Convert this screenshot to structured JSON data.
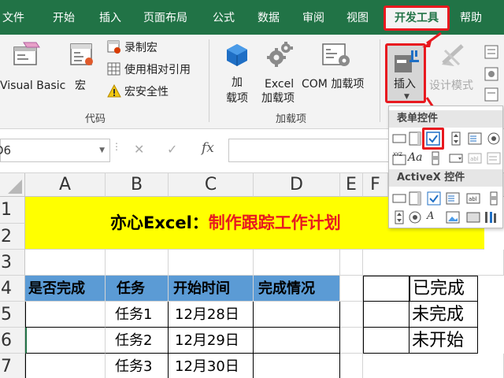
{
  "tabs": [
    "文件",
    "开始",
    "插入",
    "页面布局",
    "公式",
    "数据",
    "审阅",
    "视图",
    "开发工具",
    "帮助"
  ],
  "ribbon": {
    "visual_basic": "Visual Basic",
    "macro": "宏",
    "record_macro": "录制宏",
    "relative_ref": "使用相对引用",
    "macro_security": "宏安全性",
    "group_code": "代码",
    "addins_1": "加",
    "addins_2": "载项",
    "excel_addins_1": "Excel",
    "excel_addins_2": "加载项",
    "com_addins": "COM 加载项",
    "group_addins": "加载项",
    "insert": "插入",
    "design_mode": "设计模式"
  },
  "formula_bar": {
    "name_box": "D6",
    "cancel_icon": "✕",
    "enter_icon": "✓",
    "fx": "fx"
  },
  "dropdown": {
    "form_controls": "表单控件",
    "activex_controls": "ActiveX 控件"
  },
  "sheet": {
    "columns": [
      "A",
      "B",
      "C",
      "D",
      "E",
      "F"
    ],
    "rows": [
      "1",
      "2",
      "3",
      "4",
      "5",
      "6",
      "7"
    ],
    "title_black": "亦心Excel：",
    "title_red": "制作跟踪工作计划",
    "headers": [
      "是否完成",
      "任务",
      "开始时间",
      "完成情况"
    ],
    "tasks": [
      "任务1",
      "任务2",
      "任务3"
    ],
    "dates": [
      "12月28日",
      "12月29日",
      "12月30日"
    ],
    "status_list": [
      "已完成",
      "未完成",
      "未开始"
    ]
  },
  "colors": {
    "ribbon_green": "#217346",
    "highlight_red": "#e8191f",
    "title_yellow": "#ffff00",
    "header_blue": "#5b9bd5"
  }
}
